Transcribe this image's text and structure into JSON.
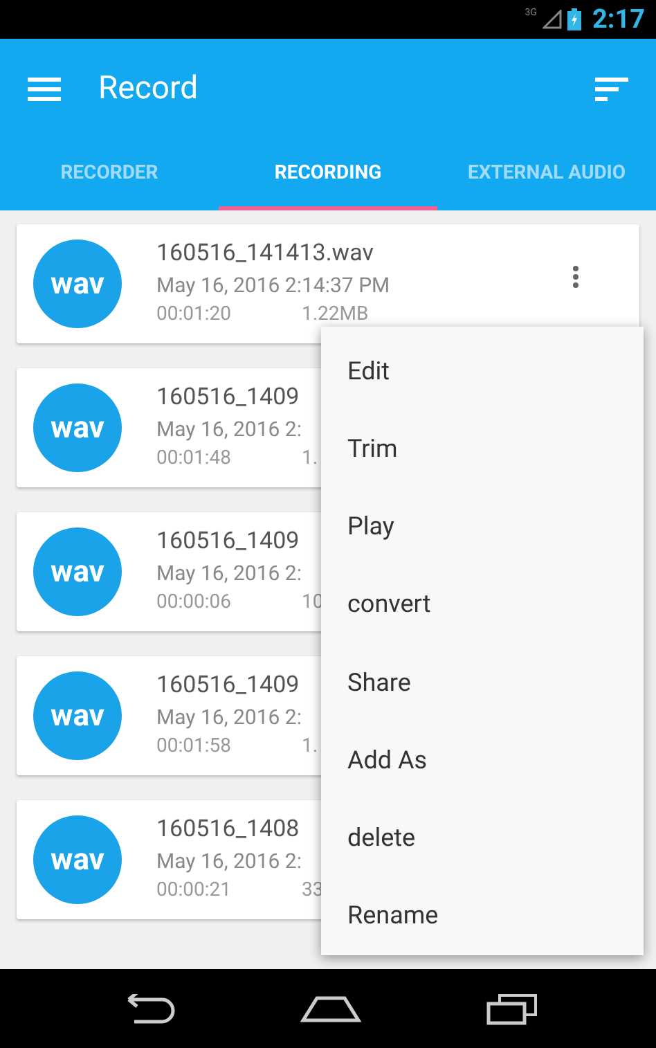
{
  "status_bar": {
    "time": "2:17",
    "network": "3G"
  },
  "app_bar": {
    "title": "Record"
  },
  "tabs": [
    {
      "label": "RECORDER",
      "selected": false
    },
    {
      "label": "RECORDING",
      "selected": true
    },
    {
      "label": "EXTERNAL AUDIO",
      "selected": false
    }
  ],
  "recordings": [
    {
      "badge": "wav",
      "name": "160516_141413.wav",
      "date": "May 16, 2016 2:14:37 PM",
      "duration": "00:01:20",
      "size": "1.22MB",
      "has_more_button": true
    },
    {
      "badge": "wav",
      "name": "160516_1409",
      "date": "May 16, 2016 2:",
      "duration": "00:01:48",
      "size": "1."
    },
    {
      "badge": "wav",
      "name": "160516_1409",
      "date": "May 16, 2016 2:",
      "duration": "00:00:06",
      "size": "10"
    },
    {
      "badge": "wav",
      "name": "160516_1409",
      "date": "May 16, 2016 2:",
      "duration": "00:01:58",
      "size": "1."
    },
    {
      "badge": "wav",
      "name": "160516_1408",
      "date": "May 16, 2016 2:",
      "duration": "00:00:21",
      "size": "33"
    }
  ],
  "menu": [
    "Edit",
    "Trim",
    "Play",
    "convert",
    "Share",
    "Add As",
    "delete",
    "Rename"
  ]
}
